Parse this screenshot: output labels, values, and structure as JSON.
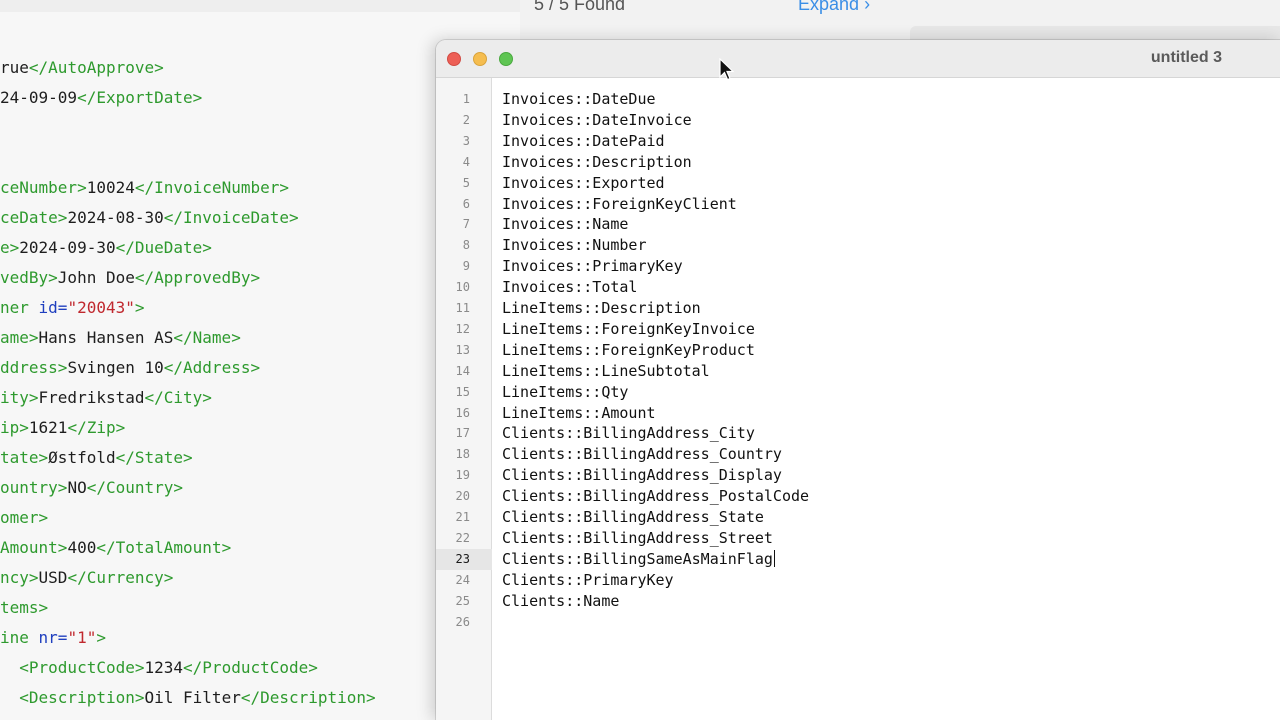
{
  "background_topbar": {
    "found_text": "5 / 5 Found",
    "expand_label": "Expand",
    "expand_icon": "chevron-right-icon"
  },
  "background_xml_lines": [
    [
      {
        "t": "rue",
        "c": "txt"
      },
      {
        "t": "</AutoApprove>",
        "c": "tag"
      }
    ],
    [
      {
        "t": "24-09-09",
        "c": "txt"
      },
      {
        "t": "</ExportDate>",
        "c": "tag"
      }
    ],
    [],
    [],
    [
      {
        "t": "ceNumber>",
        "c": "tag"
      },
      {
        "t": "10024",
        "c": "txt"
      },
      {
        "t": "</InvoiceNumber>",
        "c": "tag"
      }
    ],
    [
      {
        "t": "ceDate>",
        "c": "tag"
      },
      {
        "t": "2024-08-30",
        "c": "txt"
      },
      {
        "t": "</InvoiceDate>",
        "c": "tag"
      }
    ],
    [
      {
        "t": "e>",
        "c": "tag"
      },
      {
        "t": "2024-09-30",
        "c": "txt"
      },
      {
        "t": "</DueDate>",
        "c": "tag"
      }
    ],
    [
      {
        "t": "vedBy>",
        "c": "tag"
      },
      {
        "t": "John Doe",
        "c": "txt"
      },
      {
        "t": "</ApprovedBy>",
        "c": "tag"
      }
    ],
    [
      {
        "t": "ner ",
        "c": "tag"
      },
      {
        "t": "id=",
        "c": "attr"
      },
      {
        "t": "\"20043\"",
        "c": "val"
      },
      {
        "t": ">",
        "c": "tag"
      }
    ],
    [
      {
        "t": "ame>",
        "c": "tag"
      },
      {
        "t": "Hans Hansen AS",
        "c": "txt"
      },
      {
        "t": "</Name>",
        "c": "tag"
      }
    ],
    [
      {
        "t": "ddress>",
        "c": "tag"
      },
      {
        "t": "Svingen 10",
        "c": "txt"
      },
      {
        "t": "</Address>",
        "c": "tag"
      }
    ],
    [
      {
        "t": "ity>",
        "c": "tag"
      },
      {
        "t": "Fredrikstad",
        "c": "txt"
      },
      {
        "t": "</City>",
        "c": "tag"
      }
    ],
    [
      {
        "t": "ip>",
        "c": "tag"
      },
      {
        "t": "1621",
        "c": "txt"
      },
      {
        "t": "</Zip>",
        "c": "tag"
      }
    ],
    [
      {
        "t": "tate>",
        "c": "tag"
      },
      {
        "t": "Østfold",
        "c": "txt"
      },
      {
        "t": "</State>",
        "c": "tag"
      }
    ],
    [
      {
        "t": "ountry>",
        "c": "tag"
      },
      {
        "t": "NO",
        "c": "txt"
      },
      {
        "t": "</Country>",
        "c": "tag"
      }
    ],
    [
      {
        "t": "omer>",
        "c": "tag"
      }
    ],
    [
      {
        "t": "Amount>",
        "c": "tag"
      },
      {
        "t": "400",
        "c": "txt"
      },
      {
        "t": "</TotalAmount>",
        "c": "tag"
      }
    ],
    [
      {
        "t": "ncy>",
        "c": "tag"
      },
      {
        "t": "USD",
        "c": "txt"
      },
      {
        "t": "</Currency>",
        "c": "tag"
      }
    ],
    [
      {
        "t": "tems>",
        "c": "tag"
      }
    ],
    [
      {
        "t": "ine ",
        "c": "tag"
      },
      {
        "t": "nr=",
        "c": "attr"
      },
      {
        "t": "\"1\"",
        "c": "val"
      },
      {
        "t": ">",
        "c": "tag"
      }
    ],
    [
      {
        "t": "  <ProductCode>",
        "c": "tag"
      },
      {
        "t": "1234",
        "c": "txt"
      },
      {
        "t": "</ProductCode>",
        "c": "tag"
      }
    ],
    [
      {
        "t": "  <Description>",
        "c": "tag"
      },
      {
        "t": "Oil Filter",
        "c": "txt"
      },
      {
        "t": "</Description>",
        "c": "tag"
      }
    ]
  ],
  "editor": {
    "title": "untitled 3",
    "active_line": 23,
    "lines": [
      "Invoices::DateDue",
      "Invoices::DateInvoice",
      "Invoices::DatePaid",
      "Invoices::Description",
      "Invoices::Exported",
      "Invoices::ForeignKeyClient",
      "Invoices::Name",
      "Invoices::Number",
      "Invoices::PrimaryKey",
      "Invoices::Total",
      "LineItems::Description",
      "LineItems::ForeignKeyInvoice",
      "LineItems::ForeignKeyProduct",
      "LineItems::LineSubtotal",
      "LineItems::Qty",
      "LineItems::Amount",
      "Clients::BillingAddress_City",
      "Clients::BillingAddress_Country",
      "Clients::BillingAddress_Display",
      "Clients::BillingAddress_PostalCode",
      "Clients::BillingAddress_State",
      "Clients::BillingAddress_Street",
      "Clients::BillingSameAsMainFlag",
      "Clients::PrimaryKey",
      "Clients::Name",
      ""
    ]
  },
  "colors": {
    "xml_tag": "#2e9a2e",
    "xml_attr": "#1f3fbf",
    "xml_value": "#c0282e",
    "close": "#ed5f56",
    "minimize": "#f5bd4f",
    "zoom": "#5fc553",
    "link": "#3a8ee6"
  }
}
